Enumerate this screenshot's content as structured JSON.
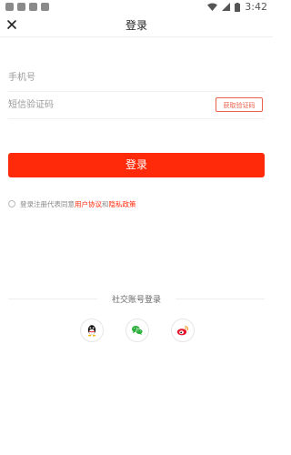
{
  "status_bar": {
    "time": "3:42"
  },
  "nav": {
    "title": "登录",
    "close_icon": "close-icon"
  },
  "form": {
    "phone_placeholder": "手机号",
    "code_placeholder": "短信验证码",
    "get_code_label": "获取验证码",
    "login_label": "登录"
  },
  "agreement": {
    "prefix": "登录注册代表同意",
    "user_agreement": "用户协议",
    "and": "和",
    "privacy_policy": "隐私政策"
  },
  "social": {
    "title": "社交账号登录",
    "options": [
      {
        "icon": "qq-icon"
      },
      {
        "icon": "wechat-icon"
      },
      {
        "icon": "weibo-icon"
      }
    ]
  },
  "colors": {
    "accent": "#ff2a0a",
    "code_button_border": "#e8604a",
    "wechat_green": "#2aae3a",
    "weibo_red": "#e6162d"
  }
}
